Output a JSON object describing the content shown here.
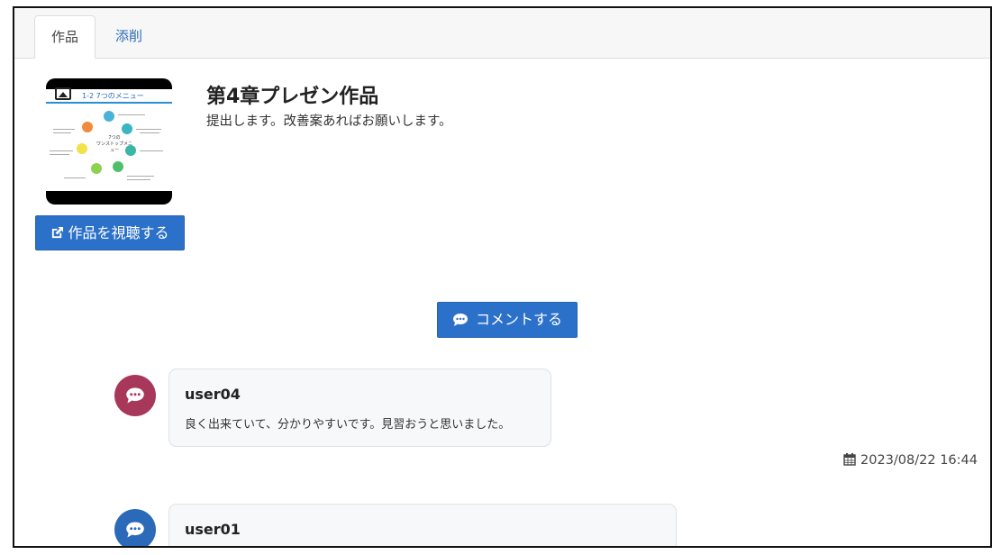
{
  "tabs": [
    {
      "label": "作品",
      "active": true
    },
    {
      "label": "添削",
      "active": false
    }
  ],
  "work": {
    "title": "第4章プレゼン作品",
    "description": "提出します。改善案あればお願いします。",
    "view_button_label": "作品を視聴する",
    "view_button_icon": "external-link-icon",
    "thumbnail": {
      "slide_title": "1-2 7つのメニュー",
      "center_label_1": "7つの",
      "center_label_2": "ワンストップメニュー"
    }
  },
  "comment_button": {
    "label": "コメントする",
    "icon": "comment-icon"
  },
  "comments": [
    {
      "user": "user04",
      "text": "良く出来ていて、分かりやすいです。見習おうと思いました。",
      "timestamp": "2023/08/22 16:44",
      "avatar_color": "#a8385a"
    },
    {
      "user": "user01",
      "text": "",
      "timestamp": "",
      "avatar_color": "#2a6ab8"
    }
  ],
  "colors": {
    "primary_button": "#2c71c9",
    "tab_link": "#2a6ab8"
  }
}
